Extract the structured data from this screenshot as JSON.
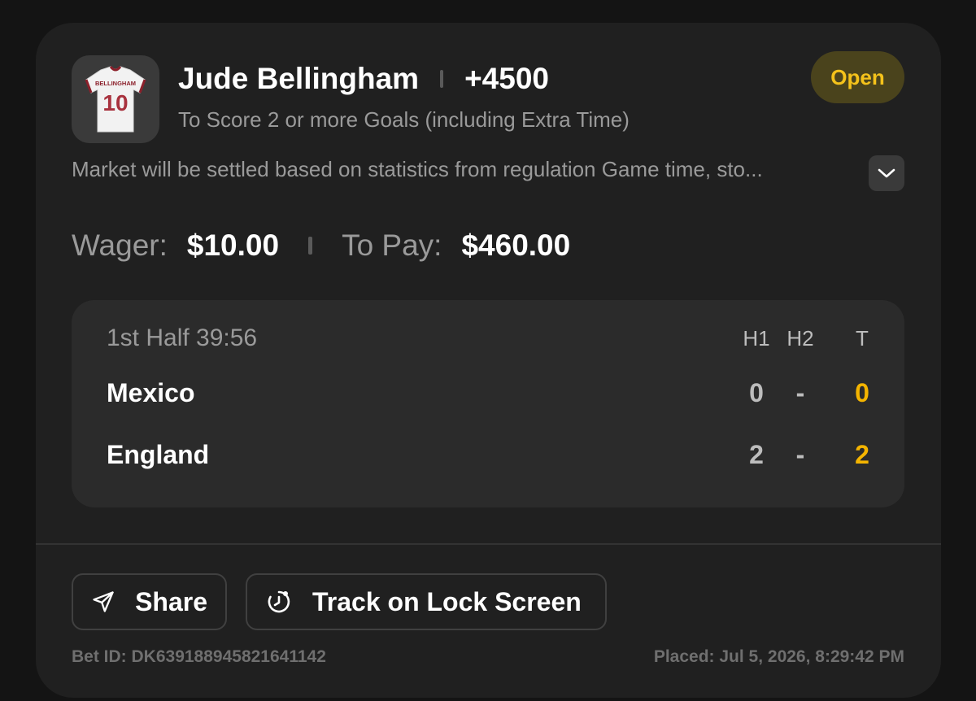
{
  "bet": {
    "player_name": "Jude Bellingham",
    "odds": "+4500",
    "market": "To Score 2 or more Goals (including Extra Time)",
    "status": "Open",
    "rules": "Market will be settled based on statistics from regulation Game time, sto...",
    "jersey": {
      "name": "BELLINGHAM",
      "number": "10"
    }
  },
  "wager": {
    "wager_label": "Wager:",
    "wager_value": "$10.00",
    "pay_label": "To Pay:",
    "pay_value": "$460.00"
  },
  "scoreboard": {
    "period": "1st Half 39:56",
    "headers": {
      "h1": "H1",
      "h2": "H2",
      "t": "T"
    },
    "teams": [
      {
        "name": "Mexico",
        "h1": "0",
        "h2": "-",
        "t": "0"
      },
      {
        "name": "England",
        "h1": "2",
        "h2": "-",
        "t": "2"
      }
    ]
  },
  "actions": {
    "share": "Share",
    "track": "Track on Lock Screen"
  },
  "footer": {
    "bet_id": "Bet ID: DK639188945821641142",
    "placed": "Placed: Jul 5, 2026, 8:29:42 PM"
  },
  "colors": {
    "accent": "#f4c21b",
    "status_bg": "#4a431c",
    "card_bg": "#202020",
    "page_bg": "#141414"
  },
  "icons": {
    "expand": "chevron-down-icon",
    "share": "send-icon",
    "track": "lock-screen-timer-icon"
  }
}
